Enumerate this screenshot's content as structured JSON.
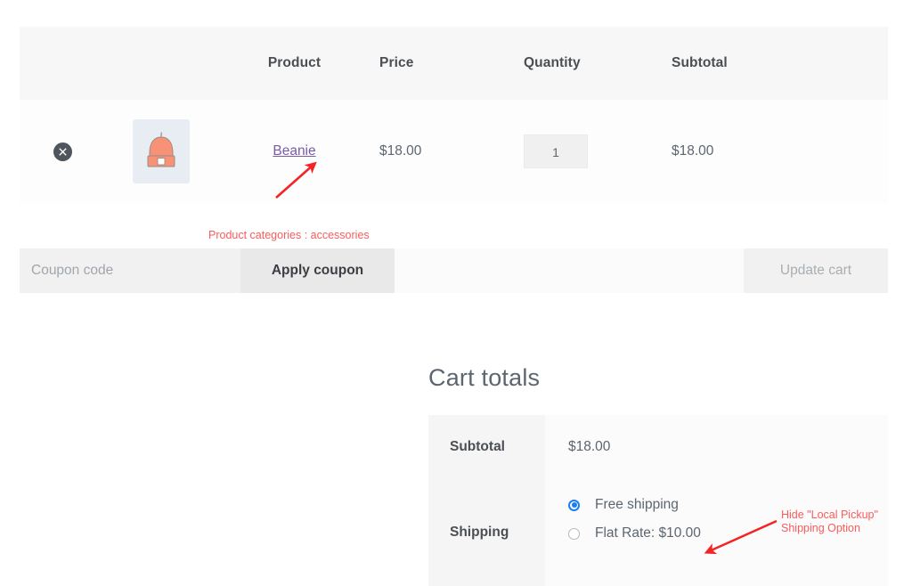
{
  "cart_table": {
    "columns": [
      "",
      "",
      "Product",
      "Price",
      "Quantity",
      "Subtotal"
    ],
    "headers": {
      "product": "Product",
      "price": "Price",
      "quantity": "Quantity",
      "subtotal": "Subtotal"
    },
    "rows": [
      {
        "remove_icon": "remove-circle-x-icon",
        "thumbnail_icon": "beanie-product-thumbnail",
        "product_name": "Beanie",
        "price": "$18.00",
        "quantity": "1",
        "subtotal": "$18.00"
      }
    ]
  },
  "coupon": {
    "placeholder": "Coupon code",
    "value": "",
    "apply_label": "Apply coupon",
    "update_label": "Update cart"
  },
  "totals": {
    "title": "Cart totals",
    "subtotal_label": "Subtotal",
    "subtotal_value": "$18.00",
    "shipping_label": "Shipping",
    "shipping_options": [
      {
        "label": "Free shipping",
        "selected": true
      },
      {
        "label": "Flat Rate: $10.00",
        "selected": false
      }
    ]
  },
  "annotations": [
    {
      "id": "categories",
      "text": "Product categories : accessories"
    },
    {
      "id": "hide_pickup",
      "text": "Hide \"Local Pickup\"\nShipping Option"
    }
  ],
  "colors": {
    "annotation_red": "#fc5b5b",
    "link_purple": "#7a5ba8",
    "radio_blue": "#1a7ef5",
    "header_bg": "#f7f7f7",
    "beanie_coral": "#f79277"
  }
}
